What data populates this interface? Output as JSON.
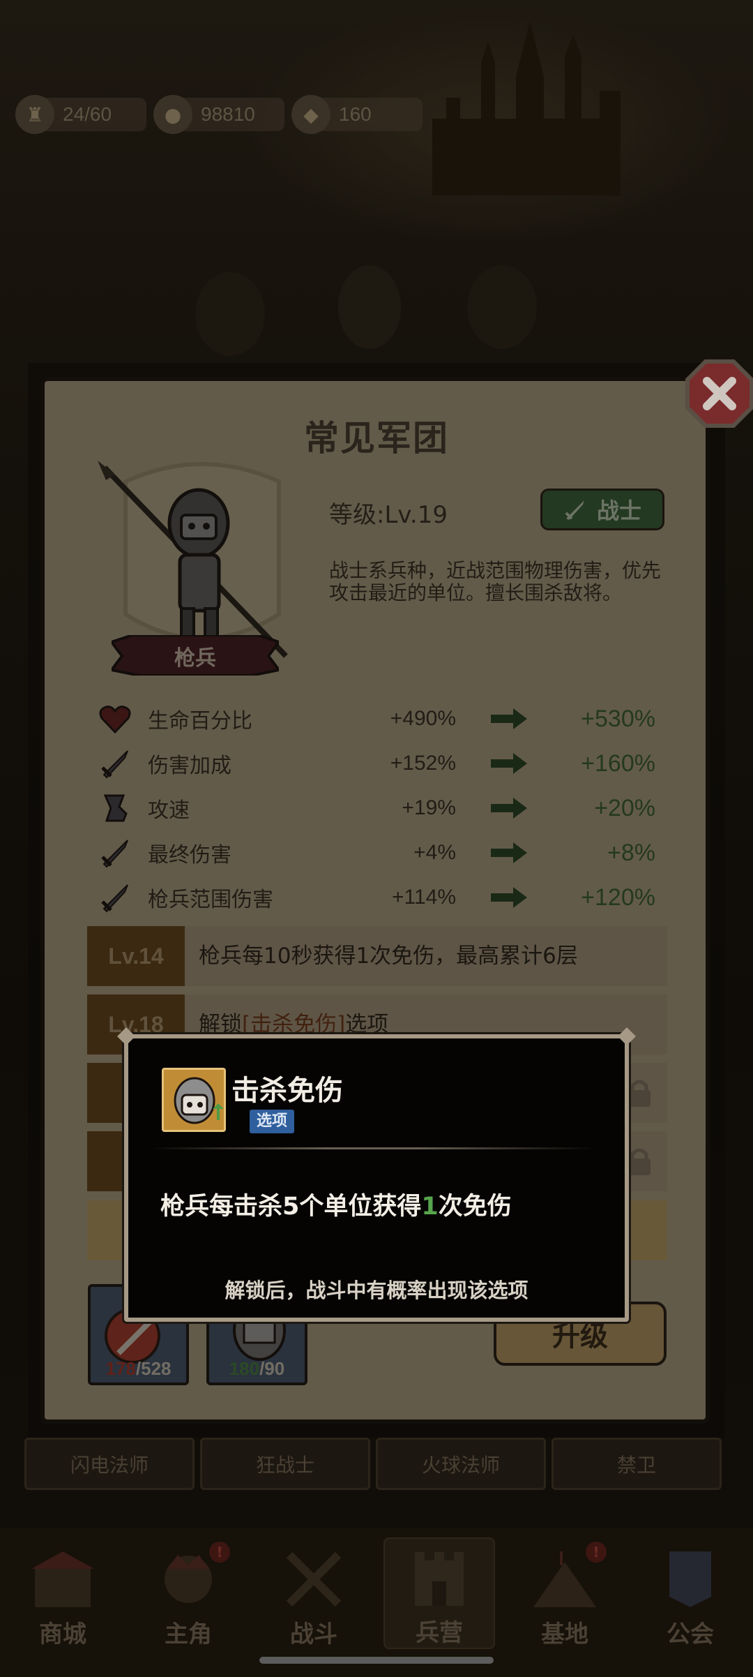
{
  "resources": {
    "stamina": "24/60",
    "gold": "98810",
    "gems": "160"
  },
  "panel": {
    "title": "常见军团",
    "level_label": "等级:",
    "level_value": "Lv.19",
    "class_badge": "战士",
    "hero_name": "枪兵",
    "description": "战士系兵种，近战范围物理伤害，优先攻击最近的单位。擅长围杀敌将。",
    "stats": [
      {
        "icon": "heart-icon",
        "name": "生命百分比",
        "current": "+490%",
        "next": "+530%"
      },
      {
        "icon": "sword-icon",
        "name": "伤害加成",
        "current": "+152%",
        "next": "+160%"
      },
      {
        "icon": "boot-icon",
        "name": "攻速",
        "current": "+19%",
        "next": "+20%"
      },
      {
        "icon": "sword-icon",
        "name": "最终伤害",
        "current": "+4%",
        "next": "+8%"
      },
      {
        "icon": "sword-icon",
        "name": "枪兵范围伤害",
        "current": "+114%",
        "next": "+120%"
      }
    ],
    "perks": [
      {
        "level": "Lv.14",
        "text": "枪兵每10秒获得1次免伤，最高累计6层"
      },
      {
        "level": "Lv.18",
        "text_prefix": "解锁",
        "text_highlight": "[击杀免伤]",
        "text_suffix": "选项"
      }
    ],
    "cards": [
      {
        "have": "178",
        "need": "/528"
      },
      {
        "have": "180",
        "need": "/90"
      }
    ],
    "upgrade_label": "升级"
  },
  "popup": {
    "title": "击杀免伤",
    "tag": "选项",
    "desc_prefix": "枪兵每击杀5个单位获得",
    "desc_number": "1",
    "desc_suffix": "次免伤",
    "footer": "解锁后，战斗中有概率出现该选项"
  },
  "background_tabs": [
    "闪电法师",
    "狂战士",
    "火球法师",
    "禁卫"
  ],
  "bottom_nav": [
    {
      "label": "商城",
      "icon": "shop-icon",
      "badge": false
    },
    {
      "label": "主角",
      "icon": "hero-icon",
      "badge": true
    },
    {
      "label": "战斗",
      "icon": "crossed-swords-icon",
      "badge": false
    },
    {
      "label": "兵营",
      "icon": "barracks-icon",
      "badge": false,
      "active": true
    },
    {
      "label": "基地",
      "icon": "base-icon",
      "badge": true
    },
    {
      "label": "公会",
      "icon": "guild-icon",
      "badge": false
    }
  ],
  "colors": {
    "next_value": "#3f6a35",
    "class_badge": "#3f6a3c",
    "popup_tag": "#2f5f9d",
    "highlight_number": "#58a54d"
  }
}
